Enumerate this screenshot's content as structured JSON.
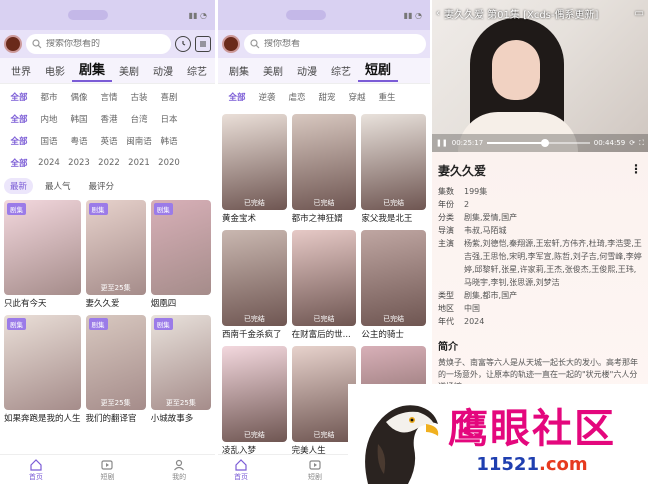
{
  "panel1": {
    "search_placeholder": "搜索你想看的",
    "tabs": [
      "世界",
      "电影",
      "剧集",
      "美剧",
      "动漫",
      "综艺"
    ],
    "active_tab": "剧集",
    "filters": [
      [
        "全部",
        "都市",
        "偶像",
        "言情",
        "古装",
        "喜剧"
      ],
      [
        "全部",
        "内地",
        "韩国",
        "香港",
        "台湾",
        "日本"
      ],
      [
        "全部",
        "国语",
        "粤语",
        "英语",
        "闽南语",
        "韩语"
      ],
      [
        "全部",
        "2024",
        "2023",
        "2022",
        "2021",
        "2020"
      ]
    ],
    "sort": [
      "最新",
      "最人气",
      "最评分"
    ],
    "cards": [
      {
        "title": "只此有今天",
        "badge": "剧集",
        "ep": ""
      },
      {
        "title": "妻久久爱",
        "badge": "剧集",
        "ep": "更至25集"
      },
      {
        "title": "烟凰四",
        "badge": "剧集",
        "ep": ""
      },
      {
        "title": "如果奔跑是我的人生",
        "badge": "剧集",
        "ep": ""
      },
      {
        "title": "我们的翻译官",
        "badge": "剧集",
        "ep": "更至25集"
      },
      {
        "title": "小城故事多",
        "badge": "剧集",
        "ep": "更至25集"
      }
    ],
    "nav": [
      "首页",
      "短剧",
      "我的"
    ]
  },
  "panel2": {
    "search_placeholder": "搜你想看",
    "tabs": [
      "剧集",
      "美剧",
      "动漫",
      "综艺",
      "短剧"
    ],
    "active_tab": "短剧",
    "filters": [
      "全部",
      "逆袭",
      "虐恋",
      "甜宠",
      "穿越",
      "重生"
    ],
    "cards": [
      {
        "title": "黄金宝术",
        "ep": "已完结"
      },
      {
        "title": "都市之神狂婿",
        "ep": "已完结"
      },
      {
        "title": "家父我是北王",
        "ep": "已完结"
      },
      {
        "title": "西南千金杀疯了",
        "ep": "已完结"
      },
      {
        "title": "在财富后的世...",
        "ep": "已完结"
      },
      {
        "title": "公主的骑士",
        "ep": "已完结"
      },
      {
        "title": "凌乱入梦",
        "ep": "已完结"
      },
      {
        "title": "完美人生",
        "ep": "已完结"
      },
      {
        "title": "",
        "ep": ""
      }
    ],
    "nav": [
      "首页",
      "短剧"
    ]
  },
  "panel3": {
    "video_title": "妻久久爱 第01集 [Xcds-偶系更新]",
    "time_current": "00:25:17",
    "time_total": "00:44:59",
    "progress": 0.56,
    "show_title": "妻久久爱",
    "info": [
      {
        "label": "集数",
        "value": "199集"
      },
      {
        "label": "年份",
        "value": "2"
      },
      {
        "label": "分类",
        "value": "剧集,爱情,国产"
      },
      {
        "label": "导演",
        "value": "韦叔,马陌城"
      },
      {
        "label": "主演",
        "value": "杨紫,刘德恺,秦翔源,王宏轩,方伟齐,杜琦,李浩雯,王吉强,王思怡,宋明,李军宣,陈哲,刘子吉,何雪峰,李婷婷,邱黎轩,张星,许家莉,王杰,张俊杰,王俊熙,王玮,马晓宇,李钊,张思源,刘梦洁"
      },
      {
        "label": "类型",
        "value": "剧集,都市,国产"
      },
      {
        "label": "地区",
        "value": "中国"
      },
      {
        "label": "年代",
        "value": "2024"
      }
    ],
    "intro_head": "简介",
    "intro": "黄焕子、南富等六人是从天城一起长大的发小。高考那年的一场意外，让原本的轨迹一直在一起的\"状元楼\"六人分道扬镳……"
  },
  "watermark": {
    "main": "鹰眼社区",
    "url_a": "11521",
    "url_b": ".com"
  },
  "colors": {
    "accent": "#7b5cd6",
    "status_bg": "#d9d1f2",
    "watermark_pink": "#e4077d",
    "watermark_blue": "#1f3fb0",
    "watermark_orange": "#e63a1f"
  }
}
